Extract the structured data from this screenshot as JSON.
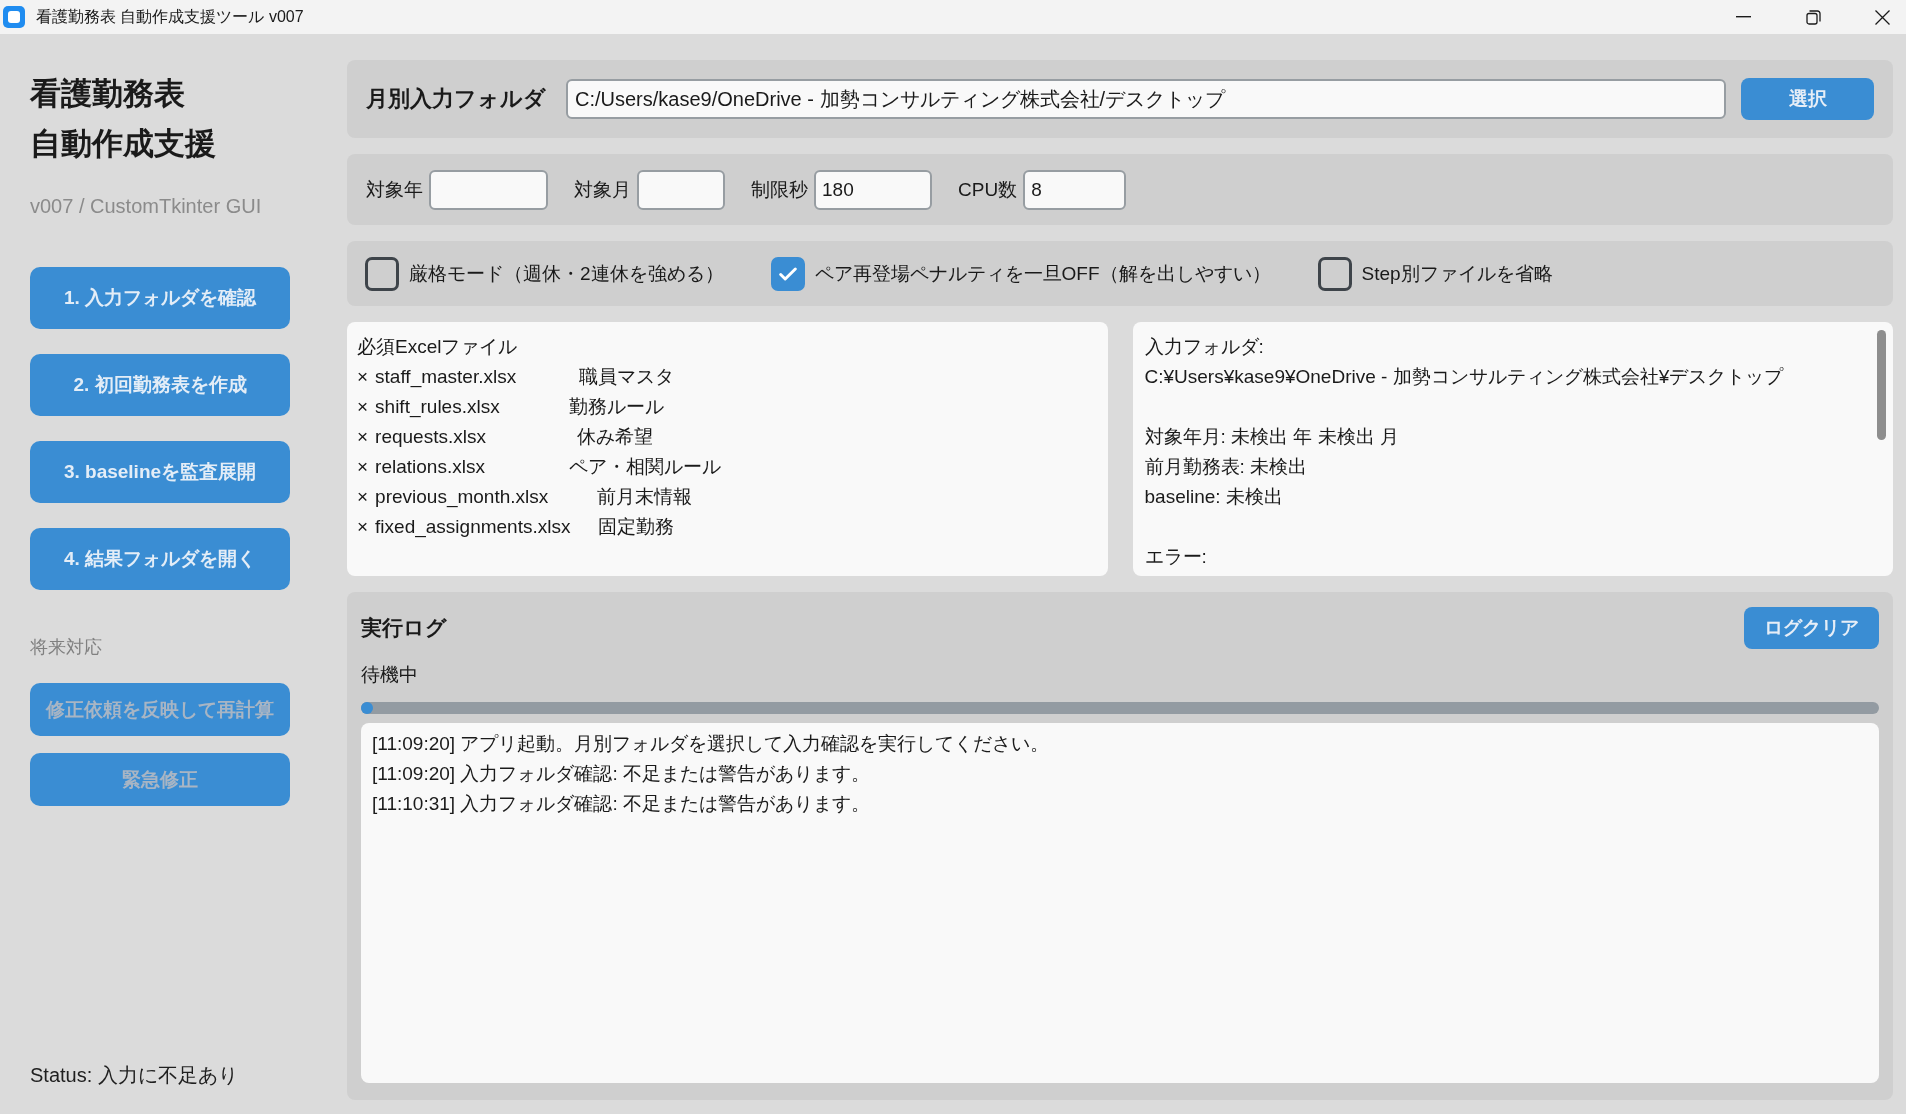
{
  "window": {
    "title": "看護勤務表 自動作成支援ツール v007"
  },
  "sidebar": {
    "title_lines": [
      "看護勤務表",
      "自動作成支援"
    ],
    "subtitle": "v007 / CustomTkinter GUI",
    "actions": [
      {
        "label": "1. 入力フォルダを確認",
        "disabled": false
      },
      {
        "label": "2. 初回勤務表を作成",
        "disabled": false
      },
      {
        "label": "3. baselineを監査展開",
        "disabled": false
      },
      {
        "label": "4. 結果フォルダを開く",
        "disabled": false
      }
    ],
    "future_heading": "将来対応",
    "future_actions": [
      {
        "label": "修正依頼を反映して再計算",
        "disabled": true
      },
      {
        "label": "緊急修正",
        "disabled": true
      }
    ],
    "status": "Status: 入力に不足あり"
  },
  "folder_bar": {
    "label": "月別入力フォルダ",
    "value": "C:/Users/kase9/OneDrive - 加勢コンサルティング株式会社/デスクトップ",
    "button": "選択"
  },
  "params": [
    {
      "label": "対象年"
    },
    {
      "label": "対象月"
    },
    {
      "label": "制限秒",
      "value": "180"
    },
    {
      "label": "CPU数",
      "value": "8"
    }
  ],
  "options": [
    {
      "label": "厳格モード（週休・2連休を強める）",
      "checked": false
    },
    {
      "label": "ペア再登場ペナルティを一旦OFF（解を出しやすい）",
      "checked": true
    },
    {
      "label": "Step別ファイルを省略",
      "checked": false
    }
  ],
  "required_files": {
    "heading": "必須Excelファイル",
    "lines": [
      "× staff_master.xlsx         職員マスタ",
      "× shift_rules.xlsx          勤務ルール",
      "× requests.xlsx             休み希望",
      "× relations.xlsx            ペア・相関ルール",
      "× previous_month.xlsx       前月末情報",
      "× fixed_assignments.xlsx    固定勤務"
    ]
  },
  "info_box": {
    "blocks": [
      [
        "入力フォルダ:",
        "C:¥Users¥kase9¥OneDrive - 加勢コンサルティング株式会社¥デスクトップ"
      ],
      [
        "対象年月: 未検出 年 未検出 月",
        "前月勤務表: 未検出",
        "baseline: 未検出"
      ],
      [
        "エラー:"
      ]
    ]
  },
  "log": {
    "title": "実行ログ",
    "clear_button": "ログクリア",
    "state": "待機中",
    "progress": {
      "level": 0
    },
    "lines": [
      "[11:09:20] アプリ起動。月別フォルダを選択して入力確認を実行してください。",
      "[11:09:20] 入力フォルダ確認: 不足または警告があります。",
      "[11:10:31] 入力フォルダ確認: 不足または警告があります。"
    ]
  }
}
